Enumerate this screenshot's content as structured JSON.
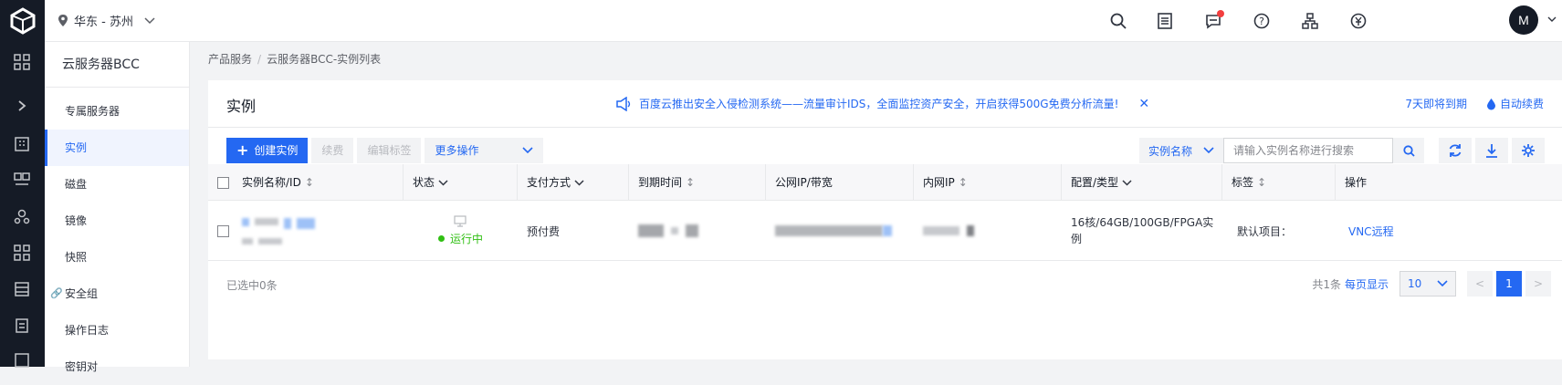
{
  "header": {
    "region": "华东 - 苏州",
    "avatar_initial": "M"
  },
  "sidebar": {
    "title": "云服务器BCC",
    "items": [
      {
        "label": "专属服务器"
      },
      {
        "label": "实例"
      },
      {
        "label": "磁盘"
      },
      {
        "label": "镜像"
      },
      {
        "label": "快照"
      },
      {
        "label": "安全组"
      },
      {
        "label": "操作日志"
      },
      {
        "label": "密钥对"
      }
    ]
  },
  "breadcrumb": {
    "root": "产品服务",
    "separator": "/",
    "current": "云服务器BCC-实例列表"
  },
  "page": {
    "title": "实例",
    "notice": "百度云推出安全入侵检测系统——流量审计IDS，全面监控资产安全，开启获得500G免费分析流量!",
    "expire_link": "7天即将到期",
    "auto_renew": "自动续费"
  },
  "toolbar": {
    "create": "创建实例",
    "renew": "续费",
    "edit_tags": "编辑标签",
    "more": "更多操作",
    "search_field": "实例名称",
    "search_placeholder": "请输入实例名称进行搜索"
  },
  "table": {
    "columns": [
      "实例名称/ID",
      "状态",
      "支付方式",
      "到期时间",
      "公网IP/带宽",
      "内网IP",
      "配置/类型",
      "标签",
      "操作"
    ],
    "rows": [
      {
        "status": "运行中",
        "payment": "预付费",
        "config_line1": "16核/64GB/100GB/FPGA实",
        "config_line2": "例",
        "tags": "默认项目：",
        "action": "VNC远程"
      }
    ]
  },
  "footer": {
    "selected": "已选中0条",
    "total": "共1条",
    "per_page_label": "每页显示",
    "page_size": "10",
    "prev": "<",
    "current_page": "1",
    "next": ">"
  },
  "colors": {
    "primary": "#2468f2",
    "rail": "#151b26",
    "running": "#30bf13"
  }
}
